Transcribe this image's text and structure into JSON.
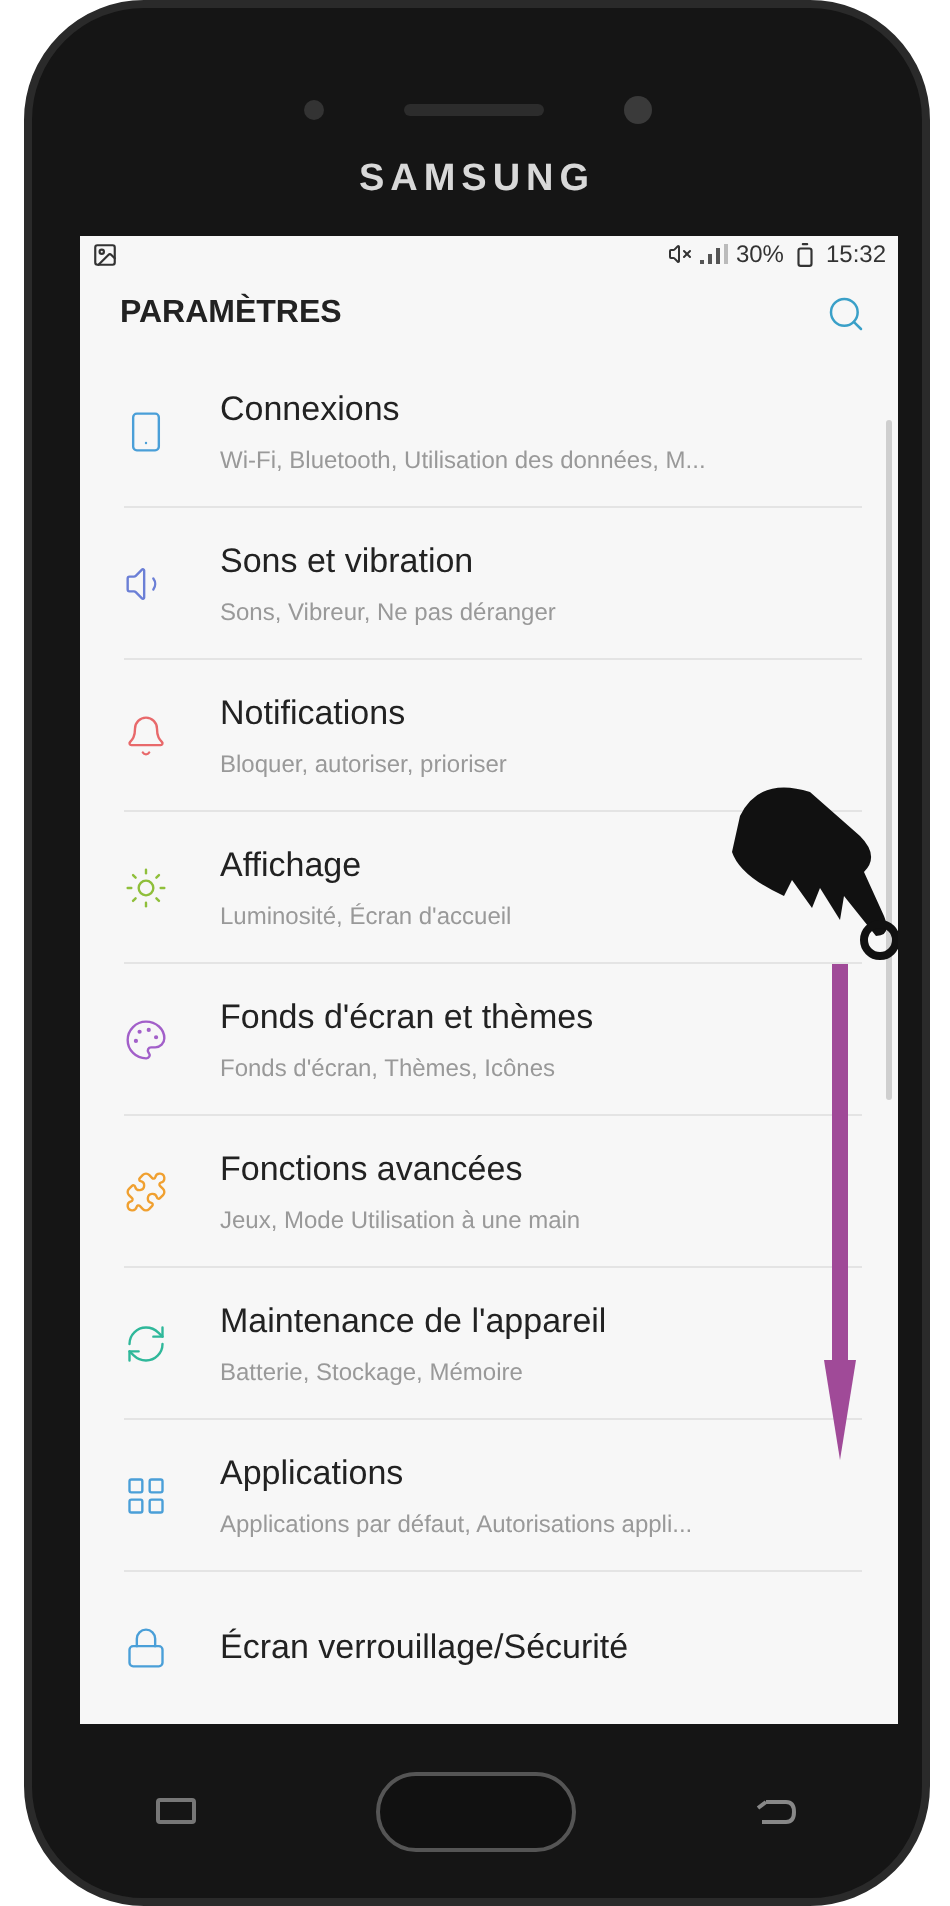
{
  "device": {
    "brand": "SAMSUNG"
  },
  "status_bar": {
    "battery": "30%",
    "time": "15:32"
  },
  "header": {
    "title": "PARAMÈTRES"
  },
  "settings": [
    {
      "title": "Connexions",
      "subtitle": "Wi-Fi, Bluetooth, Utilisation des données, M...",
      "color": "#4a9fd8"
    },
    {
      "title": "Sons et vibration",
      "subtitle": "Sons, Vibreur, Ne pas déranger",
      "color": "#6b7fd6"
    },
    {
      "title": "Notifications",
      "subtitle": "Bloquer, autoriser, prioriser",
      "color": "#e8696b"
    },
    {
      "title": "Affichage",
      "subtitle": "Luminosité, Écran d'accueil",
      "color": "#8fbf3a"
    },
    {
      "title": "Fonds d'écran et thèmes",
      "subtitle": "Fonds d'écran, Thèmes, Icônes",
      "color": "#a25fc9"
    },
    {
      "title": "Fonctions avancées",
      "subtitle": "Jeux, Mode Utilisation à une main",
      "color": "#f0a030"
    },
    {
      "title": "Maintenance de l'appareil",
      "subtitle": "Batterie, Stockage, Mémoire",
      "color": "#2fb89a"
    },
    {
      "title": "Applications",
      "subtitle": "Applications par défaut, Autorisations appli...",
      "color": "#4a9fd8"
    },
    {
      "title": "Écran verrouillage/Sécurité",
      "color": "#4a9fd8"
    }
  ]
}
